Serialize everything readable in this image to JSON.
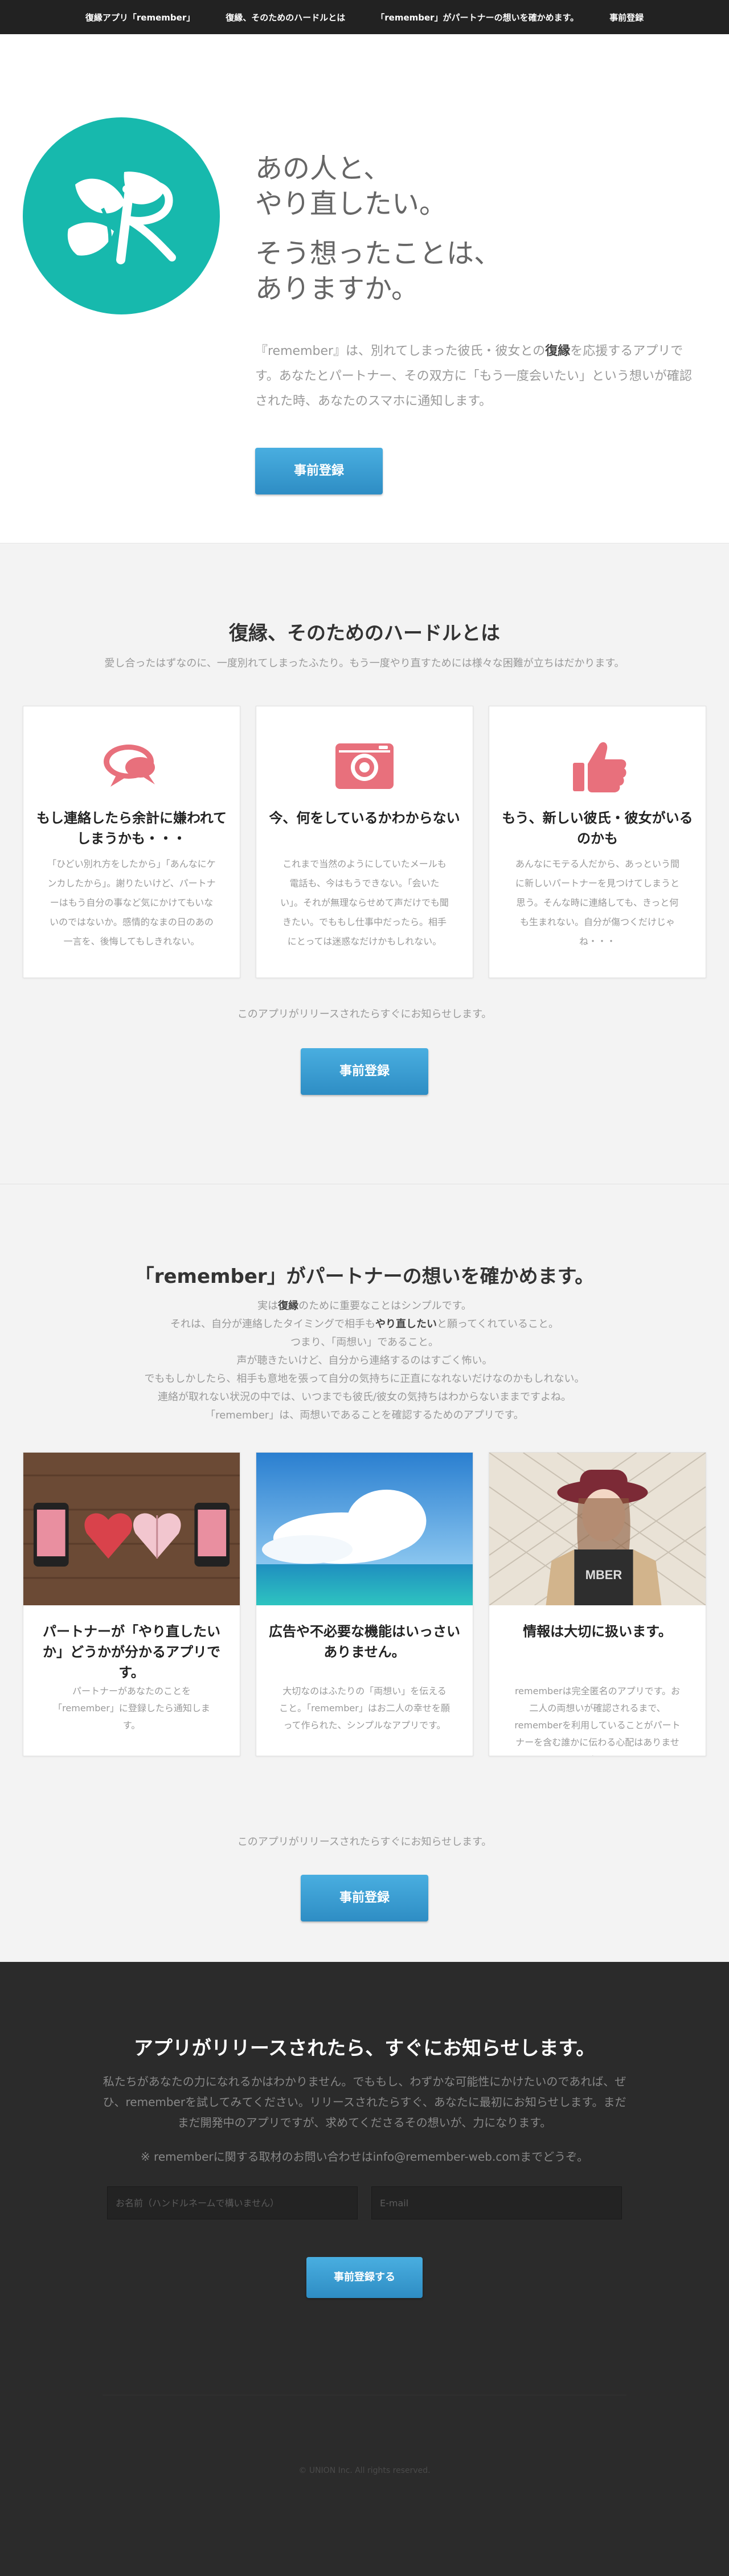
{
  "nav": {
    "items": [
      "復縁アプリ「remember」",
      "復縁、そのためのハードルとは",
      "「remember」がパートナーの想いを確かめます。",
      "事前登録"
    ]
  },
  "hero": {
    "title1_line1": "あの人と、",
    "title1_line2": "やり直したい。",
    "title2_line1": "そう想ったことは、",
    "title2_line2": "ありますか。",
    "desc_a": "『remember』は、別れてしまった彼氏・彼女との",
    "desc_bold": "復縁",
    "desc_b": "を応援するアプリです。あなたとパートナー、その双方に「もう一度会いたい」という想いが確認された時、あなたのスマホに通知します。",
    "button": "事前登録"
  },
  "hurdle": {
    "title": "復縁、そのためのハードルとは",
    "subtitle": "愛し合ったはずなのに、一度別れてしまったふたり。もう一度やり直すためには様々な困難が立ちはだかります。",
    "cards": [
      {
        "icon": "speech-bubbles-icon",
        "title": "もし連絡したら余計に嫌われてしまうかも・・・",
        "text": "「ひどい別れ方をしたから」「あんなにケンカしたから」。謝りたいけど、パートナーはもう自分の事など気にかけてもいないのではないか。感情的なまの日のあの一言を、後悔してもしきれない。"
      },
      {
        "icon": "camera-icon",
        "title": "今、何をしているかわからない",
        "text": "これまで当然のようにしていたメールも電話も、今はもうできない。「会いたい」。それが無理ならせめて声だけでも聞きたい。でももし仕事中だったら。相手にとっては迷惑なだけかもしれない。"
      },
      {
        "icon": "thumbs-up-icon",
        "title": "もう、新しい彼氏・彼女がいるのかも",
        "text": "あんなにモテる人だから、あっという間に新しいパートナーを見つけてしまうと思う。そんな時に連絡しても、きっと何も生まれない。自分が傷つくだけじゃね・・・"
      }
    ],
    "notice": "このアプリがリリースされたらすぐにお知らせします。",
    "button": "事前登録"
  },
  "confirm": {
    "title": "「remember」がパートナーの想いを確かめます。",
    "line1_a": "実は",
    "line1_bold": "復縁",
    "line1_b": "のために重要なことはシンプルです。",
    "line2_a": "それは、自分が連絡したタイミングで相手も",
    "line2_bold": "やり直したい",
    "line2_b": "と願ってくれていること。",
    "line3": "つまり、「両想い」であること。",
    "line4": "声が聴きたいけど、自分から連絡するのはすごく怖い。",
    "line5": "でももしかしたら、相手も意地を張って自分の気持ちに正直になれないだけなのかもしれない。",
    "line6": "連絡が取れない状況の中では、いつまでも彼氏/彼女の気持ちはわからないままですよね。",
    "line7": "「remember」は、両想いであることを確認するためのアプリです。",
    "cards": [
      {
        "photo": "hearts-phones-photo",
        "title": "パートナーが「やり直したいか」どうかが分かるアプリです。",
        "text": "パートナーがあなたのことを「remember」に登録したら通知します。"
      },
      {
        "photo": "sky-ocean-photo",
        "title": "広告や不必要な機能はいっさいありません。",
        "text": "大切なのはふたりの「両想い」を伝えること。「remember」はお二人の幸せを願って作られた、シンプルなアプリです。"
      },
      {
        "photo": "woman-hat-photo",
        "title": "情報は大切に扱います。",
        "text": "rememberは完全匿名のアプリです。お二人の両想いが確認されるまで、rememberを利用していることがパートナーを含む誰かに伝わる心配はありません。"
      }
    ],
    "notice": "このアプリがリリースされたらすぐにお知らせします。",
    "button": "事前登録"
  },
  "signup": {
    "title": "アプリがリリースされたら、すぐにお知らせします。",
    "desc": "私たちがあなたの力になれるかはわかりません。でももし、わずかな可能性にかけたいのであれば、ぜひ、rememberを試してみてください。リリースされたらすぐ、あなたに最初にお知らせします。まだまだ開発中のアプリですが、求めてくださるその想いが、力になります。",
    "contact": "※ rememberに関する取材のお問い合わせはinfo@remember-web.comまでどうぞ。",
    "name_placeholder": "お名前（ハンドルネームで構いません）",
    "email_placeholder": "E-mail",
    "button": "事前登録する",
    "copyright": "© UNION Inc. All rights reserved."
  },
  "colors": {
    "teal": "#17b9ad",
    "pink": "#e8707c",
    "button": "#3a9dd2",
    "dark": "#2b2b2b"
  }
}
